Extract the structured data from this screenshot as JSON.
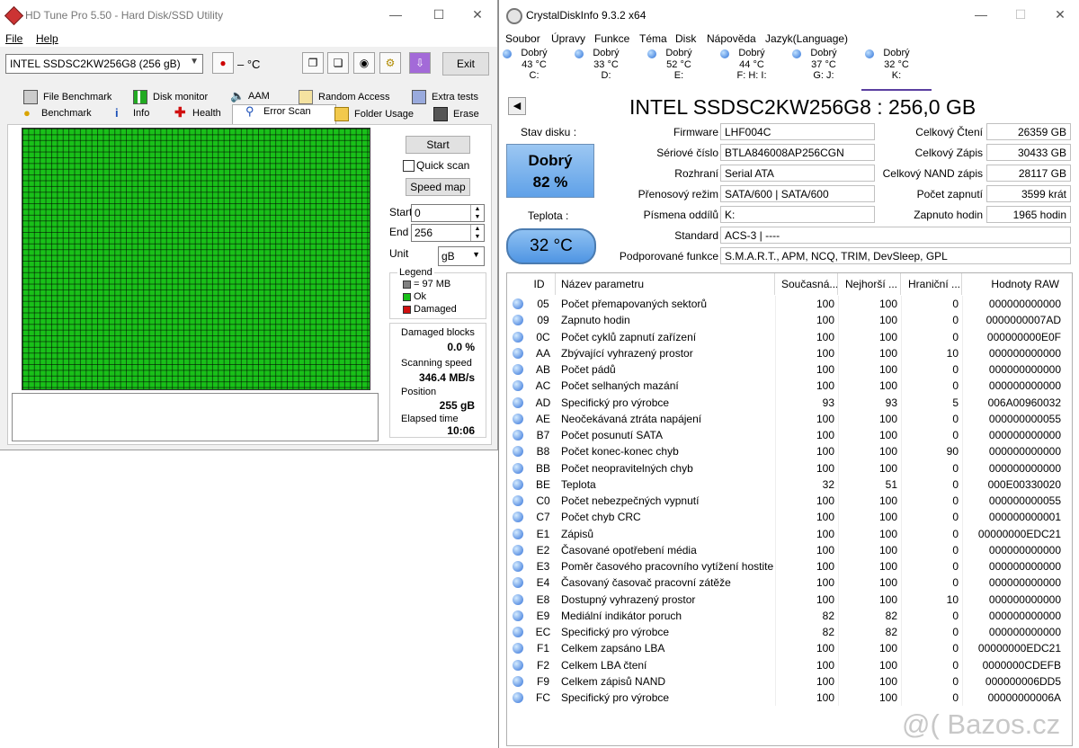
{
  "hdtune": {
    "title": "HD Tune Pro 5.50 - Hard Disk/SSD Utility",
    "menu": [
      "File",
      "Help"
    ],
    "drive_select": "INTEL SSDSC2KW256G8 (256 gB)",
    "temperature": "– °C",
    "exit_label": "Exit",
    "tabs_row1": [
      "File Benchmark",
      "Disk monitor",
      "AAM",
      "Random Access",
      "Extra tests"
    ],
    "tabs_row2": [
      "Benchmark",
      "Info",
      "Health",
      "Error Scan",
      "Folder Usage",
      "Erase"
    ],
    "active_tab": "Error Scan",
    "start_button": "Start",
    "quick_scan_label": "Quick scan",
    "speed_map_button": "Speed map",
    "start_label": "Start",
    "start_value": "0",
    "end_label": "End",
    "end_value": "256",
    "unit_label": "Unit",
    "unit_value": "gB",
    "legend_title": "Legend",
    "legend_block": "= 97 MB",
    "legend_ok": "Ok",
    "legend_damaged": "Damaged",
    "damaged_blocks_label": "Damaged blocks",
    "damaged_blocks_value": "0.0 %",
    "scanning_speed_label": "Scanning speed",
    "scanning_speed_value": "346.4 MB/s",
    "position_label": "Position",
    "position_value": "255 gB",
    "elapsed_label": "Elapsed time",
    "elapsed_value": "10:06",
    "colors": {
      "ok": "#19c019",
      "damaged": "#d01010",
      "block": "#808080"
    }
  },
  "cdi": {
    "title": "CrystalDiskInfo 9.3.2 x64",
    "menu": [
      "Soubor",
      "Úpravy",
      "Funkce",
      "Téma",
      "Disk",
      "Nápověda",
      "Jazyk(Language)"
    ],
    "drives": [
      {
        "status": "Dobrý",
        "temp": "43 °C",
        "letter": "C:"
      },
      {
        "status": "Dobrý",
        "temp": "33 °C",
        "letter": "D:"
      },
      {
        "status": "Dobrý",
        "temp": "52 °C",
        "letter": "E:"
      },
      {
        "status": "Dobrý",
        "temp": "44 °C",
        "letter": "F: H: I:"
      },
      {
        "status": "Dobrý",
        "temp": "37 °C",
        "letter": "G: J:"
      },
      {
        "status": "Dobrý",
        "temp": "32 °C",
        "letter": "K:"
      }
    ],
    "drive_title": "INTEL SSDSC2KW256G8 : 256,0 GB",
    "health_label": "Stav disku :",
    "health_status": "Dobrý",
    "health_percent": "82 %",
    "temp_label": "Teplota :",
    "temp_value": "32 °C",
    "info": {
      "firmware_label": "Firmware",
      "firmware": "LHF004C",
      "serial_label": "Sériové číslo",
      "serial": "BTLA846008AP256CGN",
      "interface_label": "Rozhraní",
      "interface": "Serial ATA",
      "transfer_label": "Přenosový režim",
      "transfer": "SATA/600 | SATA/600",
      "letters_label": "Písmena oddílů",
      "letters": "K:",
      "standard_label": "Standard",
      "standard": "ACS-3 | ----",
      "features_label": "Podporované funkce",
      "features": "S.M.A.R.T., APM, NCQ, TRIM, DevSleep, GPL",
      "total_reads_label": "Celkový Čtení",
      "total_reads": "26359 GB",
      "total_writes_label": "Celkový Zápis",
      "total_writes": "30433 GB",
      "nand_writes_label": "Celkový NAND zápis",
      "nand_writes": "28117 GB",
      "power_count_label": "Počet zapnutí",
      "power_count": "3599 krát",
      "power_hours_label": "Zapnuto hodin",
      "power_hours": "1965 hodin"
    },
    "columns": [
      "ID",
      "Název parametru",
      "Současná...",
      "Nejhorší ...",
      "Hraniční ...",
      "Hodnoty RAW"
    ],
    "rows": [
      {
        "id": "05",
        "name": "Počet přemapovaných sektorů",
        "cur": "100",
        "worst": "100",
        "thr": "0",
        "raw": "000000000000"
      },
      {
        "id": "09",
        "name": "Zapnuto hodin",
        "cur": "100",
        "worst": "100",
        "thr": "0",
        "raw": "0000000007AD"
      },
      {
        "id": "0C",
        "name": "Počet cyklů zapnutí zařízení",
        "cur": "100",
        "worst": "100",
        "thr": "0",
        "raw": "000000000E0F"
      },
      {
        "id": "AA",
        "name": "Zbývající vyhrazený prostor",
        "cur": "100",
        "worst": "100",
        "thr": "10",
        "raw": "000000000000"
      },
      {
        "id": "AB",
        "name": "Počet pádů",
        "cur": "100",
        "worst": "100",
        "thr": "0",
        "raw": "000000000000"
      },
      {
        "id": "AC",
        "name": "Počet selhaných mazání",
        "cur": "100",
        "worst": "100",
        "thr": "0",
        "raw": "000000000000"
      },
      {
        "id": "AD",
        "name": "Specifický pro výrobce",
        "cur": "93",
        "worst": "93",
        "thr": "5",
        "raw": "006A00960032"
      },
      {
        "id": "AE",
        "name": "Neočekávaná ztráta napájení",
        "cur": "100",
        "worst": "100",
        "thr": "0",
        "raw": "000000000055"
      },
      {
        "id": "B7",
        "name": "Počet posunutí SATA",
        "cur": "100",
        "worst": "100",
        "thr": "0",
        "raw": "000000000000"
      },
      {
        "id": "B8",
        "name": "Počet konec-konec chyb",
        "cur": "100",
        "worst": "100",
        "thr": "90",
        "raw": "000000000000"
      },
      {
        "id": "BB",
        "name": "Počet neopravitelných chyb",
        "cur": "100",
        "worst": "100",
        "thr": "0",
        "raw": "000000000000"
      },
      {
        "id": "BE",
        "name": "Teplota",
        "cur": "32",
        "worst": "51",
        "thr": "0",
        "raw": "000E00330020"
      },
      {
        "id": "C0",
        "name": "Počet nebezpečných vypnutí",
        "cur": "100",
        "worst": "100",
        "thr": "0",
        "raw": "000000000055"
      },
      {
        "id": "C7",
        "name": "Počet chyb CRC",
        "cur": "100",
        "worst": "100",
        "thr": "0",
        "raw": "000000000001"
      },
      {
        "id": "E1",
        "name": "Zápisů",
        "cur": "100",
        "worst": "100",
        "thr": "0",
        "raw": "00000000EDC21"
      },
      {
        "id": "E2",
        "name": "Časované opotřebení média",
        "cur": "100",
        "worst": "100",
        "thr": "0",
        "raw": "000000000000"
      },
      {
        "id": "E3",
        "name": "Poměr časového pracovního vytížení hostite...",
        "cur": "100",
        "worst": "100",
        "thr": "0",
        "raw": "000000000000"
      },
      {
        "id": "E4",
        "name": "Časovaný časovač pracovní zátěže",
        "cur": "100",
        "worst": "100",
        "thr": "0",
        "raw": "000000000000"
      },
      {
        "id": "E8",
        "name": "Dostupný vyhrazený prostor",
        "cur": "100",
        "worst": "100",
        "thr": "10",
        "raw": "000000000000"
      },
      {
        "id": "E9",
        "name": "Mediální indikátor poruch",
        "cur": "82",
        "worst": "82",
        "thr": "0",
        "raw": "000000000000"
      },
      {
        "id": "EC",
        "name": "Specifický pro výrobce",
        "cur": "82",
        "worst": "82",
        "thr": "0",
        "raw": "000000000000"
      },
      {
        "id": "F1",
        "name": "Celkem zapsáno LBA",
        "cur": "100",
        "worst": "100",
        "thr": "0",
        "raw": "00000000EDC21"
      },
      {
        "id": "F2",
        "name": "Celkem LBA čtení",
        "cur": "100",
        "worst": "100",
        "thr": "0",
        "raw": "0000000CDEFB"
      },
      {
        "id": "F9",
        "name": "Celkem zápisů NAND",
        "cur": "100",
        "worst": "100",
        "thr": "0",
        "raw": "000000006DD5"
      },
      {
        "id": "FC",
        "name": "Specifický pro výrobce",
        "cur": "100",
        "worst": "100",
        "thr": "0",
        "raw": "00000000006A"
      }
    ]
  },
  "watermark": "@( Bazos.cz"
}
